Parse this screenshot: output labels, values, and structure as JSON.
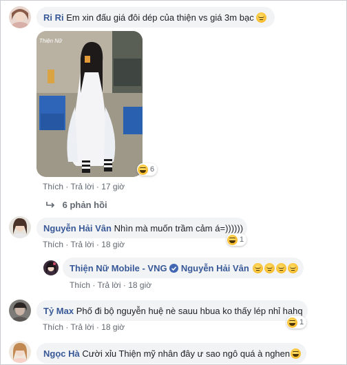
{
  "colors": {
    "name": "#385898",
    "bubble": "#f2f3f5",
    "meta": "#606770",
    "text": "#1c1e21"
  },
  "comments": [
    {
      "author": "Ri Ri",
      "text": "Em xin đấu giá đôi dép của thiện vs giá 3m bạc",
      "actions": {
        "like": "Thích",
        "reply": "Trả lời",
        "time": "17 giờ"
      },
      "reaction": {
        "icon": "haha-emoji-icon",
        "count": "6"
      },
      "photo_watermark": "Thiện Nữ"
    },
    {
      "author": "Nguyễn Hải Vân",
      "text": "Nhìn mà muốn trầm cảm á=))))))",
      "actions": {
        "like": "Thích",
        "reply": "Trả lời",
        "time": "18 giờ"
      },
      "reaction": {
        "icon": "haha-emoji-icon",
        "count": "1"
      }
    },
    {
      "author": "Thiện Nữ Mobile - VNG",
      "mention": "Nguyễn Hải Vân",
      "actions": {
        "like": "Thích",
        "reply": "Trả lời",
        "time": "18 giờ"
      }
    },
    {
      "author": "Tỷ Max",
      "text": "Phố đi bộ nguyễn huệ nè sauu hbua ko thấy lép nhỉ hahq",
      "actions": {
        "like": "Thích",
        "reply": "Trả lời",
        "time": "18 giờ"
      },
      "reaction": {
        "icon": "haha-emoji-icon",
        "count": "1"
      }
    },
    {
      "author": "Ngọc Hà",
      "text": "Cười xỉu Thiện mỹ nhân đây ư sao ngô quá à nghen"
    }
  ],
  "replies_toggle": {
    "label": "6 phản hồi",
    "icon": "reply-arrow-icon"
  }
}
